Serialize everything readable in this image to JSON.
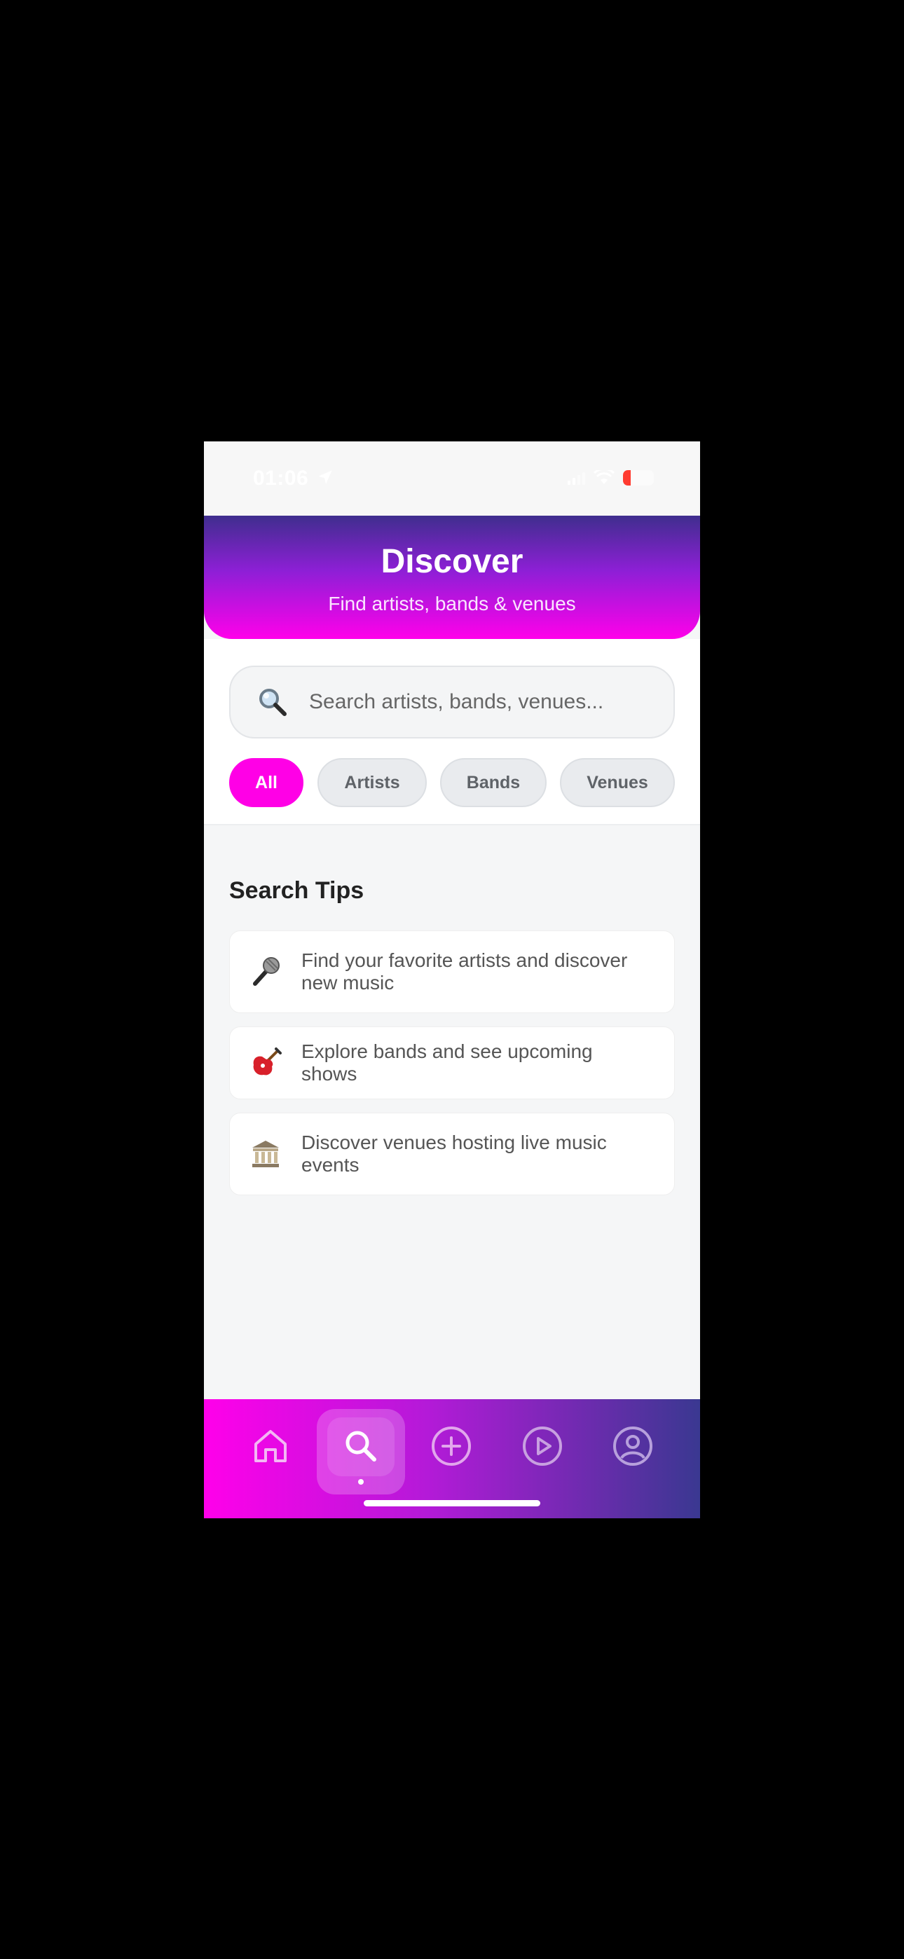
{
  "status_bar": {
    "time": "01:06"
  },
  "header": {
    "title": "Discover",
    "subtitle": "Find artists, bands & venues"
  },
  "search": {
    "placeholder": "Search artists, bands, venues...",
    "icon": "magnifying-glass-icon"
  },
  "filters": [
    {
      "label": "All",
      "active": true
    },
    {
      "label": "Artists",
      "active": false
    },
    {
      "label": "Bands",
      "active": false
    },
    {
      "label": "Venues",
      "active": false
    }
  ],
  "tips": {
    "title": "Search Tips",
    "items": [
      {
        "icon": "microphone-icon",
        "emoji": "🎤",
        "text": "Find your favorite artists and discover new music"
      },
      {
        "icon": "guitar-icon",
        "emoji": "🎸",
        "text": "Explore bands and see upcoming shows"
      },
      {
        "icon": "classical-building-icon",
        "emoji": "🏛",
        "text": "Discover venues hosting live music events"
      }
    ]
  },
  "tab_bar": {
    "items": [
      "home-icon",
      "search-icon",
      "add-circle-icon",
      "play-circle-icon",
      "profile-circle-icon"
    ],
    "active": "search-icon"
  },
  "colors": {
    "accent": "#ff00e6",
    "header_gradient_top": "#3f2e8e",
    "header_gradient_bottom": "#ff00ea",
    "tabbar_gradient_left": "#ff00ea",
    "tabbar_gradient_right": "#3a3891"
  }
}
